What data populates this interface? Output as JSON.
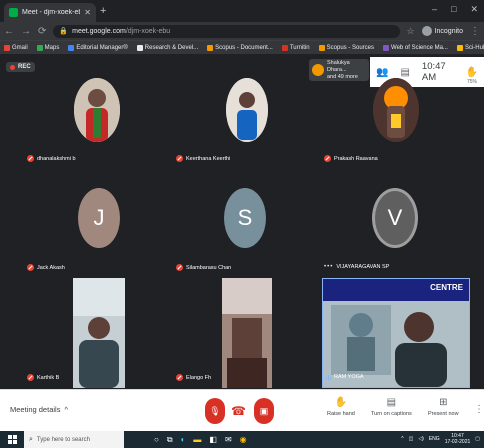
{
  "browser": {
    "tab_title": "Meet - djm-xoek-ebu",
    "tab_close": "✕",
    "new_tab": "+",
    "window_controls": [
      "–",
      "□",
      "✕"
    ],
    "url_host": "meet.google.com",
    "url_path": "/djm-xoek-ebu",
    "profile_label": "Incognito",
    "bookmarks": [
      {
        "label": "Gmail",
        "color": "#ea4335"
      },
      {
        "label": "Maps",
        "color": "#34a853"
      },
      {
        "label": "Editorial Manager®",
        "color": "#4285f4"
      },
      {
        "label": "Research & Devel...",
        "color": "#e8eaed"
      },
      {
        "label": "Scopus - Document...",
        "color": "#f29900"
      },
      {
        "label": "Turnitin",
        "color": "#d93025"
      },
      {
        "label": "Scopus - Sources",
        "color": "#f29900"
      },
      {
        "label": "Web of Science Ma...",
        "color": "#7e57c2"
      },
      {
        "label": "Sci-Hub: removing...",
        "color": "#fbbc04"
      },
      {
        "label": "Author Search - We...",
        "color": "#8ab4f8"
      }
    ]
  },
  "meet": {
    "rec_label": "REC",
    "presenter_chip": {
      "line1": "Shalukya Dhara...",
      "line2": "and 49 more"
    },
    "clock": "10:47 AM",
    "zoom_label": "75%",
    "participants": [
      {
        "name": "dhanalakshmi b",
        "indicator": "muted"
      },
      {
        "name": "Keerthana Keerthi",
        "indicator": "muted"
      },
      {
        "name": "Prakash Raavana",
        "indicator": "muted"
      },
      {
        "name": "Jack Akash",
        "indicator": "muted",
        "initial": "J",
        "color": "#a1887f"
      },
      {
        "name": "Silambarasu Chan",
        "indicator": "muted",
        "initial": "S",
        "color": "#78909c"
      },
      {
        "name": "VIJAYARAGAVAN SP",
        "indicator": "dots",
        "initial": "V",
        "color": "#6d6d6d"
      },
      {
        "name": "Karthik B",
        "indicator": "muted"
      },
      {
        "name": "Elango Fh",
        "indicator": "muted"
      },
      {
        "name": "RAM YOGA",
        "indicator": "speaking"
      }
    ],
    "banner_text": "CENTRE"
  },
  "controls": {
    "meeting_details": "Meeting details",
    "raise_hand": "Raise hand",
    "captions": "Turn on captions",
    "present": "Present now"
  },
  "taskbar": {
    "search_placeholder": "Type here to search",
    "tray_lang": "ENG",
    "time": "10:47",
    "date": "17-02-2021"
  }
}
